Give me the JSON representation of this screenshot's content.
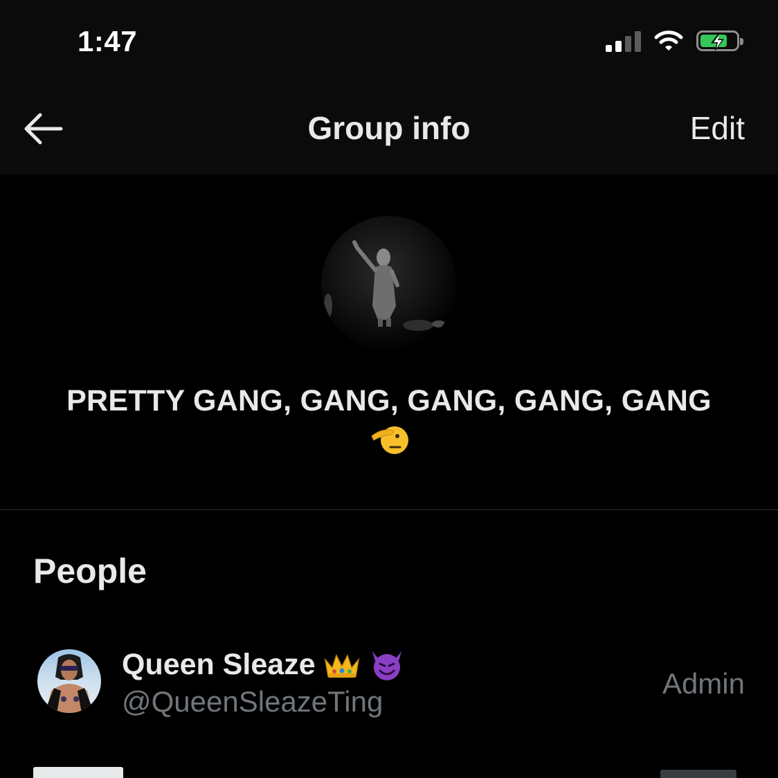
{
  "status_bar": {
    "time": "1:47",
    "battery_color": "#34c759"
  },
  "header": {
    "title": "Group info",
    "edit_label": "Edit",
    "back_icon": "arrow-left-icon"
  },
  "group": {
    "name": "PRETTY GANG, GANG, GANG, GANG, GANG",
    "emoji": "saluting-face-emoji"
  },
  "people": {
    "section_title": "People",
    "members": [
      {
        "name": "Queen Sleaze",
        "emojis": [
          "crown-emoji",
          "smiling-devil-emoji"
        ],
        "handle": "@QueenSleazeTing",
        "role": "Admin"
      }
    ]
  },
  "colors": {
    "background": "#000000",
    "header_bg": "#0b0b0b",
    "text": "#e7e9ea",
    "muted": "#71767b",
    "divider": "#2f3336"
  }
}
